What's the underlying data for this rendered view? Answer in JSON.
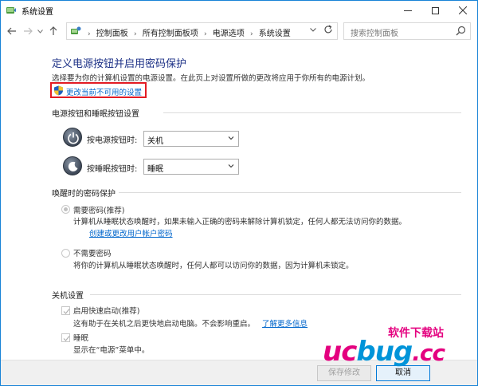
{
  "window": {
    "title": "系统设置",
    "accent": "#1883d7"
  },
  "nav": {
    "breadcrumbs": [
      "控制面板",
      "所有控制面板项",
      "电源选项",
      "系统设置"
    ],
    "search_placeholder": "搜索控制面板"
  },
  "main": {
    "title": "定义电源按钮并启用密码保护",
    "description": "选择要为你的计算机设置的电源设置。在此页上对设置所做的更改将应用于你所有的电源计划。",
    "change_link": "更改当前不可用的设置",
    "power_section": {
      "heading": "电源按钮和睡眠按钮设置",
      "power_button_label": "按电源按钮时:",
      "power_button_value": "关机",
      "sleep_button_label": "按睡眠按钮时:",
      "sleep_button_value": "睡眠"
    },
    "password_section": {
      "heading": "唤醒时的密码保护",
      "require_label": "需要密码(推荐)",
      "require_desc": "计算机从睡眠状态唤醒时，如果未输入正确的密码来解除计算机锁定，任何人都无法访问你的数据。",
      "require_link": "创建或更改用户帐户密码",
      "norequire_label": "不需要密码",
      "norequire_desc": "将你的计算机从睡眠状态唤醒时，任何人都可以访问你的数据，因为计算机未锁定。"
    },
    "shutdown_section": {
      "heading": "关机设置",
      "fast_startup_label": "启用快速启动(推荐)",
      "fast_startup_desc": "这有助于在关机之后更快地启动电脑。不会影响重启。",
      "learn_more": "了解更多信息",
      "sleep_label": "睡眠",
      "sleep_desc": "显示在“电源”菜单中。"
    }
  },
  "footer": {
    "save_label": "保存修改",
    "cancel_label": "取消"
  },
  "watermark": {
    "small": "软件下载站",
    "big_uc": "uc",
    "big_bug": "bug",
    "big_cc": ".cc"
  }
}
